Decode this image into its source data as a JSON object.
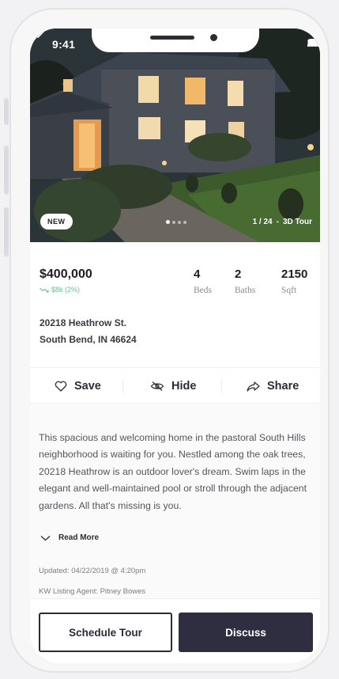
{
  "status_bar": {
    "time": "9:41"
  },
  "photo": {
    "badge": "NEW",
    "counter": "1 / 24",
    "separator": "-",
    "tour_label": "3D Tour"
  },
  "listing": {
    "price": "$400,000",
    "price_change": "$8k (2%)",
    "beds": {
      "value": "4",
      "label": "Beds"
    },
    "baths": {
      "value": "2",
      "label": "Baths"
    },
    "sqft": {
      "value": "2150",
      "label": "Sqft"
    },
    "address_line1": "20218 Heathrow St.",
    "address_line2": "South Bend, IN 46624"
  },
  "actions": {
    "save": "Save",
    "hide": "Hide",
    "share": "Share"
  },
  "description": {
    "text": "This spacious and welcoming home in the pastoral South Hills neighborhood is waiting for you. Nestled among the oak trees, 20218 Heathrow is an outdoor lover's dream. Swim laps in the elegant and well-maintained pool or stroll through the adjacent gardens. All that's missing is you.",
    "read_more": "Read More",
    "updated": "Updated: 04/22/2019 @ 4:20pm",
    "agent": "KW Listing Agent: Pitney Bowes"
  },
  "buttons": {
    "schedule": "Schedule Tour",
    "discuss": "Discuss"
  },
  "colors": {
    "accent_dark": "#2e2e40",
    "trend_green": "#59c78a"
  }
}
